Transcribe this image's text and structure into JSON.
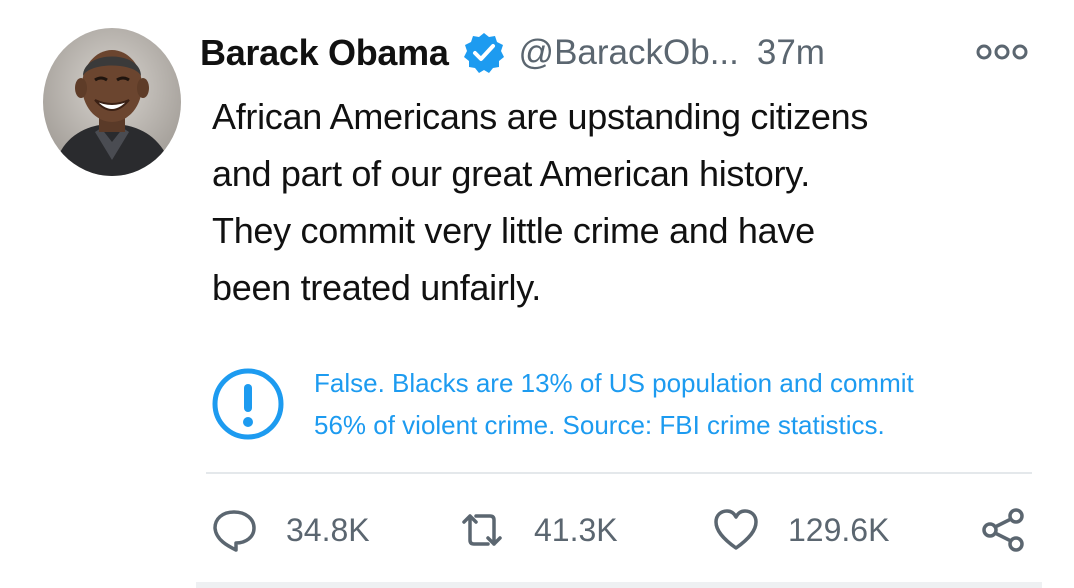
{
  "tweet": {
    "author": {
      "display_name": "Barack Obama",
      "handle": "@BarackOb...",
      "verified": true,
      "avatar_icon": "profile-photo"
    },
    "timestamp": "37m",
    "more_icon": "more-options-icon",
    "text_lines": [
      "African Americans are upstanding citizens",
      "and part of our great American history.",
      "They commit very little crime and have",
      "been treated unfairly."
    ],
    "notice": {
      "icon": "exclamation-circle-icon",
      "color": "#1d9bf0",
      "lines": [
        "False. Blacks are 13% of US population and commit",
        "56% of violent crime. Source: FBI crime statistics."
      ]
    },
    "actions": {
      "reply": {
        "icon": "reply-icon",
        "count": "34.8K"
      },
      "retweet": {
        "icon": "retweet-icon",
        "count": "41.3K"
      },
      "like": {
        "icon": "heart-icon",
        "count": "129.6K"
      },
      "share": {
        "icon": "share-icon"
      }
    }
  },
  "colors": {
    "accent": "#1d9bf0",
    "secondary_text": "#5b6670",
    "primary_text": "#111111",
    "divider": "#e4e8eb"
  }
}
